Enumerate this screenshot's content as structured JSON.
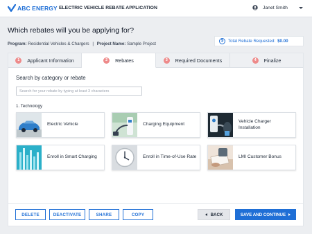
{
  "header": {
    "logo_text": "ABC ENERGY",
    "app_title": "ELECTRIC VEHICLE REBATE APPLICATION",
    "user_name": "Janet Smith",
    "brand_color": "#1f6fd6"
  },
  "page": {
    "heading": "Which rebates will you be applying for?",
    "program_label": "Program:",
    "program_value": "Residential Vehicles & Chargers",
    "separator": "|",
    "project_label": "Project Name:",
    "project_value": "Sample Project",
    "total_label": "Total Rebate Requested:",
    "total_value": "$0.00"
  },
  "tabs": [
    {
      "num": "1",
      "label": "Applicant Information",
      "active": false
    },
    {
      "num": "2",
      "label": "Rebates",
      "active": true
    },
    {
      "num": "3",
      "label": "Required Documents",
      "active": false
    },
    {
      "num": "4",
      "label": "Finalize",
      "active": false
    }
  ],
  "search": {
    "heading": "Search by category or rebate",
    "placeholder": "Search for your rebate by typing at least 3 characters",
    "value": ""
  },
  "category": {
    "title": "1. Technology",
    "items": [
      {
        "label": "Electric Vehicle",
        "icon": "electric-vehicle-photo"
      },
      {
        "label": "Charging Equipment",
        "icon": "charging-equipment-photo"
      },
      {
        "label": "Vehicle Charger Installation",
        "icon": "charger-installation-photo"
      },
      {
        "label": "Enroll in Smart Charging",
        "icon": "smart-charging-photo"
      },
      {
        "label": "Enroll in Time-of-Use Rate",
        "icon": "time-of-use-clock-photo"
      },
      {
        "label": "LMI Customer Bonus",
        "icon": "customer-bonus-photo"
      }
    ]
  },
  "footer": {
    "delete_label": "DELETE",
    "deactivate_label": "DEACTIVATE",
    "share_label": "SHARE",
    "copy_label": "COPY",
    "back_label": "BACK",
    "continue_label": "SAVE AND CONTINUE"
  }
}
